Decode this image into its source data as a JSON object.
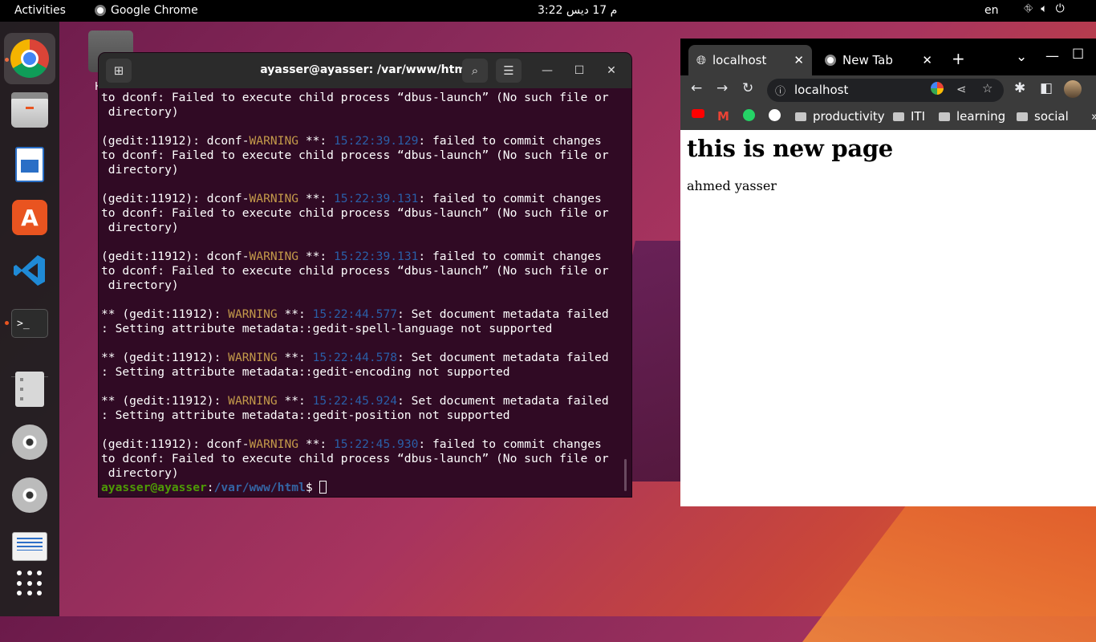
{
  "topbar": {
    "activities": "Activities",
    "app_name": "Google Chrome",
    "clock": "3:22 م  17 ديس",
    "language": "en"
  },
  "dock": {
    "items": [
      "chrome",
      "files",
      "libreoffice-writer",
      "ubuntu-software",
      "vscode",
      "terminal",
      "text-editor",
      "disc-1",
      "disc-2",
      "scanner",
      "show-apps"
    ]
  },
  "desktop": {
    "home_label": "H"
  },
  "terminal": {
    "title": "ayasser@ayasser: /var/www/html",
    "lines": [
      [
        {
          "t": "to dconf: Failed to execute child process “dbus-launch” (No such file or"
        }
      ],
      [
        {
          "t": " directory)"
        }
      ],
      [
        {
          "t": ""
        }
      ],
      [
        {
          "t": "(gedit:11912): dconf-"
        },
        {
          "t": "WARNING",
          "c": "warn"
        },
        {
          "t": " **: "
        },
        {
          "t": "15:22:39.129",
          "c": "ts"
        },
        {
          "t": ": failed to commit changes"
        }
      ],
      [
        {
          "t": "to dconf: Failed to execute child process “dbus-launch” (No such file or"
        }
      ],
      [
        {
          "t": " directory)"
        }
      ],
      [
        {
          "t": ""
        }
      ],
      [
        {
          "t": "(gedit:11912): dconf-"
        },
        {
          "t": "WARNING",
          "c": "warn"
        },
        {
          "t": " **: "
        },
        {
          "t": "15:22:39.131",
          "c": "ts"
        },
        {
          "t": ": failed to commit changes"
        }
      ],
      [
        {
          "t": "to dconf: Failed to execute child process “dbus-launch” (No such file or"
        }
      ],
      [
        {
          "t": " directory)"
        }
      ],
      [
        {
          "t": ""
        }
      ],
      [
        {
          "t": "(gedit:11912): dconf-"
        },
        {
          "t": "WARNING",
          "c": "warn"
        },
        {
          "t": " **: "
        },
        {
          "t": "15:22:39.131",
          "c": "ts"
        },
        {
          "t": ": failed to commit changes"
        }
      ],
      [
        {
          "t": "to dconf: Failed to execute child process “dbus-launch” (No such file or"
        }
      ],
      [
        {
          "t": " directory)"
        }
      ],
      [
        {
          "t": ""
        }
      ],
      [
        {
          "t": "** (gedit:11912): "
        },
        {
          "t": "WARNING",
          "c": "warn"
        },
        {
          "t": " **: "
        },
        {
          "t": "15:22:44.577",
          "c": "ts"
        },
        {
          "t": ": Set document metadata failed"
        }
      ],
      [
        {
          "t": ": Setting attribute metadata::gedit-spell-language not supported"
        }
      ],
      [
        {
          "t": ""
        }
      ],
      [
        {
          "t": "** (gedit:11912): "
        },
        {
          "t": "WARNING",
          "c": "warn"
        },
        {
          "t": " **: "
        },
        {
          "t": "15:22:44.578",
          "c": "ts"
        },
        {
          "t": ": Set document metadata failed"
        }
      ],
      [
        {
          "t": ": Setting attribute metadata::gedit-encoding not supported"
        }
      ],
      [
        {
          "t": ""
        }
      ],
      [
        {
          "t": "** (gedit:11912): "
        },
        {
          "t": "WARNING",
          "c": "warn"
        },
        {
          "t": " **: "
        },
        {
          "t": "15:22:45.924",
          "c": "ts"
        },
        {
          "t": ": Set document metadata failed"
        }
      ],
      [
        {
          "t": ": Setting attribute metadata::gedit-position not supported"
        }
      ],
      [
        {
          "t": ""
        }
      ],
      [
        {
          "t": "(gedit:11912): dconf-"
        },
        {
          "t": "WARNING",
          "c": "warn"
        },
        {
          "t": " **: "
        },
        {
          "t": "15:22:45.930",
          "c": "ts"
        },
        {
          "t": ": failed to commit changes"
        }
      ],
      [
        {
          "t": "to dconf: Failed to execute child process “dbus-launch” (No such file or"
        }
      ],
      [
        {
          "t": " directory)"
        }
      ]
    ],
    "prompt_user": "ayasser@ayasser",
    "prompt_sep": ":",
    "prompt_path": "/var/www/html",
    "prompt_end": "$ "
  },
  "chrome": {
    "tabs": [
      {
        "title": "localhost",
        "active": true
      },
      {
        "title": "New Tab",
        "active": false
      }
    ],
    "url": "localhost",
    "bookmarks": [
      "productivity",
      "ITI",
      "learning",
      "social"
    ],
    "page": {
      "heading": "this is new page",
      "text": "ahmed yasser"
    }
  },
  "colors": {
    "terminal_bg": "#300a24",
    "warning": "#c49a4a",
    "timestamp": "#2a5fa8",
    "prompt_user": "#4e9a06",
    "prompt_path": "#3465a4",
    "ubuntu_orange": "#e95420"
  }
}
